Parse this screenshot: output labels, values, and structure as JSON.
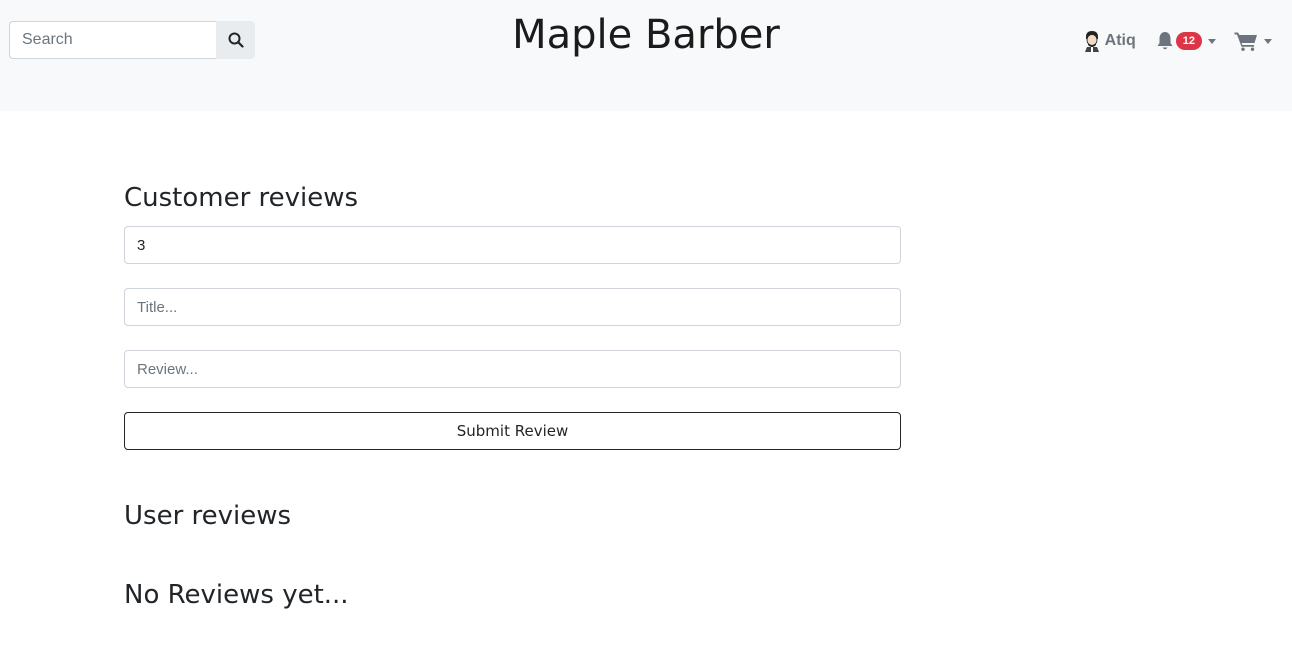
{
  "navbar": {
    "brand": "Maple Barber",
    "search": {
      "placeholder": "Search",
      "value": "",
      "button_icon": "search-icon"
    },
    "user": {
      "name": "Atiq",
      "avatar_icon": "barber-avatar-icon"
    },
    "notifications": {
      "icon": "bell-icon",
      "count": "12"
    },
    "cart": {
      "icon": "shopping-cart-icon"
    }
  },
  "review_form": {
    "heading": "Customer reviews",
    "rating_value": "3",
    "title_placeholder": "Title...",
    "review_placeholder": "Review...",
    "submit_label": "Submit Review"
  },
  "user_reviews": {
    "heading": "User reviews",
    "empty_message": "No Reviews yet..."
  },
  "colors": {
    "navbar_bg": "#f8f9fa",
    "badge": "#dc3545",
    "muted": "#6c757d"
  }
}
